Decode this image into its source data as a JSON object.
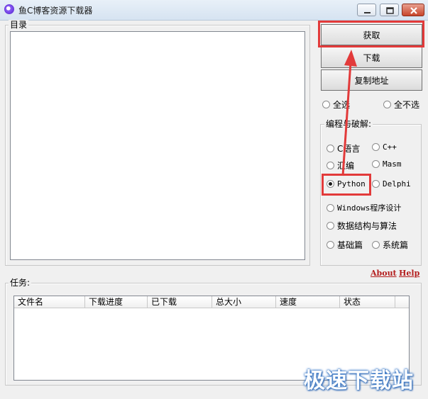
{
  "window": {
    "title": "鱼C博客资源下载器"
  },
  "catalog": {
    "label": "目录"
  },
  "actions": {
    "fetch": "获取",
    "download": "下载",
    "copy_address": "复制地址"
  },
  "selection": {
    "select_all": "全选",
    "select_none": "全不选"
  },
  "categories": {
    "label": "编程与破解:",
    "items": [
      "C语言",
      "C++",
      "汇编",
      "Masm",
      "Python",
      "Delphi",
      "Windows程序设计",
      "数据结构与算法",
      "基础篇",
      "系统篇"
    ],
    "selected": "Python"
  },
  "links": {
    "about": "About",
    "help": "Help"
  },
  "tasks": {
    "label": "任务:",
    "columns": [
      "文件名",
      "下载进度",
      "已下载",
      "总大小",
      "速度",
      "状态"
    ]
  },
  "watermark": "极速下载站",
  "annotation_color": "#e23a3a"
}
